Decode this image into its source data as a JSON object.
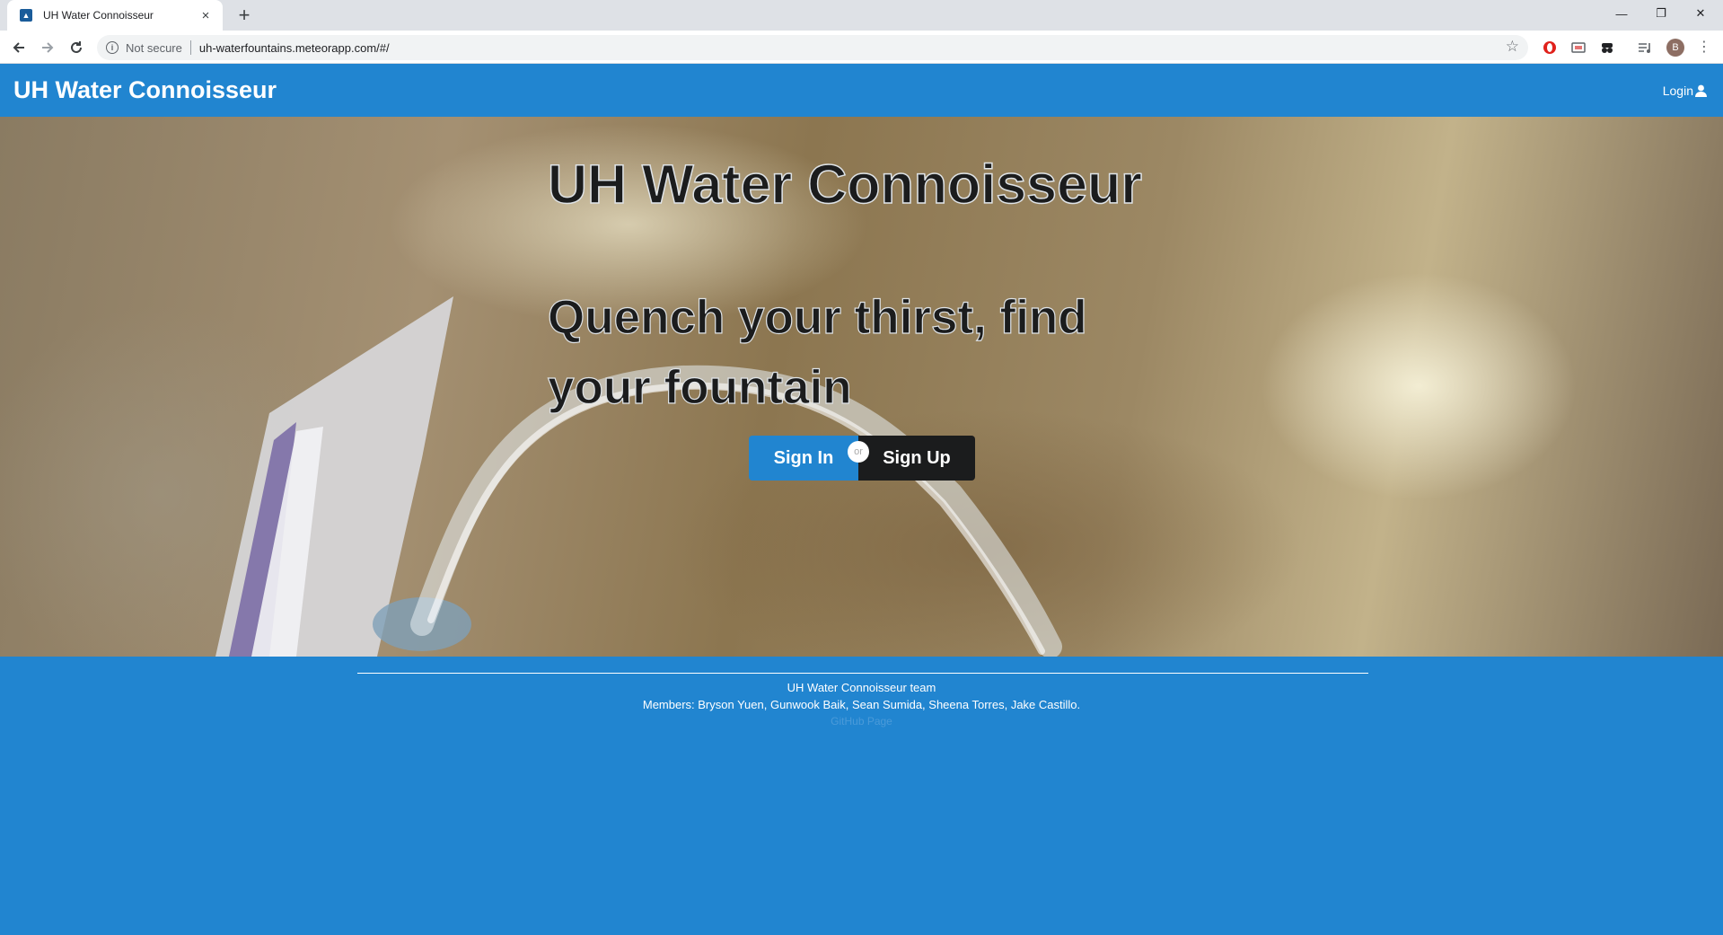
{
  "browser": {
    "tab_title": "UH Water Connoisseur",
    "tab_close": "×",
    "new_tab": "+",
    "security_label": "Not secure",
    "url": "uh-waterfountains.meteorapp.com/#/",
    "profile_initial": "B"
  },
  "navbar": {
    "brand": "UH Water Connoisseur",
    "login_label": "Login"
  },
  "hero": {
    "title": "UH Water Connoisseur",
    "tagline": "Quench your thirst, find your fountain",
    "signin_label": "Sign In",
    "or_label": "or",
    "signup_label": "Sign Up"
  },
  "footer": {
    "team": "UH Water Connoisseur team",
    "members": "Members: Bryson Yuen, Gunwook Baik, Sean Sumida, Sheena Torres, Jake Castillo.",
    "link": "GitHub Page"
  },
  "colors": {
    "accent": "#2185d0",
    "dark_button": "#1b1c1d"
  },
  "icons": [
    "info-icon",
    "star-icon",
    "user-icon",
    "back-arrow-icon",
    "forward-arrow-icon",
    "reload-icon"
  ]
}
